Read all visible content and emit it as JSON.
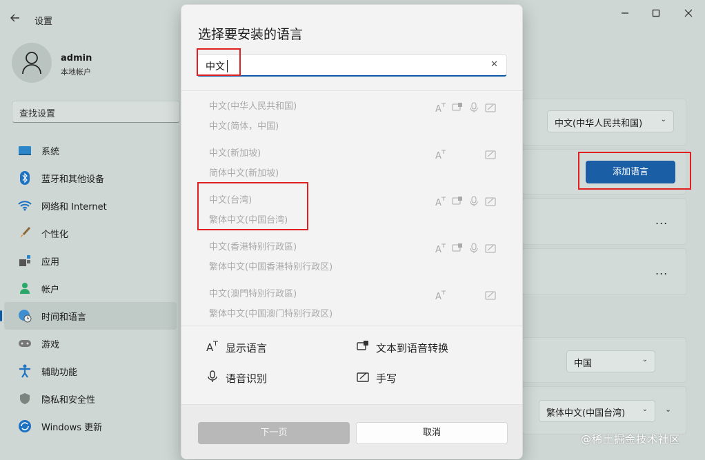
{
  "window": {
    "title": "设置",
    "back_icon": "back-arrow-icon",
    "controls": [
      "minimize-icon",
      "maximize-icon",
      "close-icon"
    ]
  },
  "profile": {
    "name": "admin",
    "account_type": "本地帐户"
  },
  "search": {
    "placeholder": "查找设置"
  },
  "sidebar": {
    "items": [
      {
        "label": "系统",
        "icon": "system-icon"
      },
      {
        "label": "蓝牙和其他设备",
        "icon": "bluetooth-icon"
      },
      {
        "label": "网络和 Internet",
        "icon": "wifi-icon"
      },
      {
        "label": "个性化",
        "icon": "brush-icon"
      },
      {
        "label": "应用",
        "icon": "apps-icon"
      },
      {
        "label": "帐户",
        "icon": "account-icon"
      },
      {
        "label": "时间和语言",
        "icon": "globe-clock-icon",
        "active": true
      },
      {
        "label": "游戏",
        "icon": "gamepad-icon"
      },
      {
        "label": "辅助功能",
        "icon": "accessibility-icon"
      },
      {
        "label": "隐私和安全性",
        "icon": "shield-icon"
      },
      {
        "label": "Windows 更新",
        "icon": "update-icon"
      }
    ]
  },
  "content": {
    "display_language_value": "中文(中华人民共和国)",
    "add_language_label": "添加语言",
    "more_label": "...",
    "region_value": "中国",
    "regional_format_value": "繁体中文(中国台湾)"
  },
  "dialog": {
    "title": "选择要安装的语言",
    "search_value": "中文",
    "clear_icon": "clear-x-icon",
    "languages": [
      {
        "name": "中文(中华人民共和国)",
        "sub": "中文(简体，中国)",
        "features": [
          "display",
          "tts",
          "speech",
          "handwriting"
        ]
      },
      {
        "name": "中文(新加坡)",
        "sub": "简体中文(新加坡)",
        "features": [
          "display",
          "handwriting"
        ]
      },
      {
        "name": "中文(台湾)",
        "sub": "繁体中文(中国台湾)",
        "features": [
          "display",
          "tts",
          "speech",
          "handwriting"
        ]
      },
      {
        "name": "中文(香港特别行政區)",
        "sub": "繁体中文(中国香港特别行政区)",
        "features": [
          "display",
          "tts",
          "speech",
          "handwriting"
        ]
      },
      {
        "name": "中文(澳門特別行政區)",
        "sub": "繁体中文(中国澳门特别行政区)",
        "features": [
          "display",
          "handwriting"
        ]
      }
    ],
    "legend": {
      "display": "显示语言",
      "tts": "文本到语音转换",
      "speech": "语音识别",
      "handwriting": "手写"
    },
    "next_label": "下一页",
    "cancel_label": "取消"
  },
  "watermark": "@稀土掘金技术社区",
  "colors": {
    "accent": "#1a5fa6",
    "highlight_box": "#e02020"
  }
}
